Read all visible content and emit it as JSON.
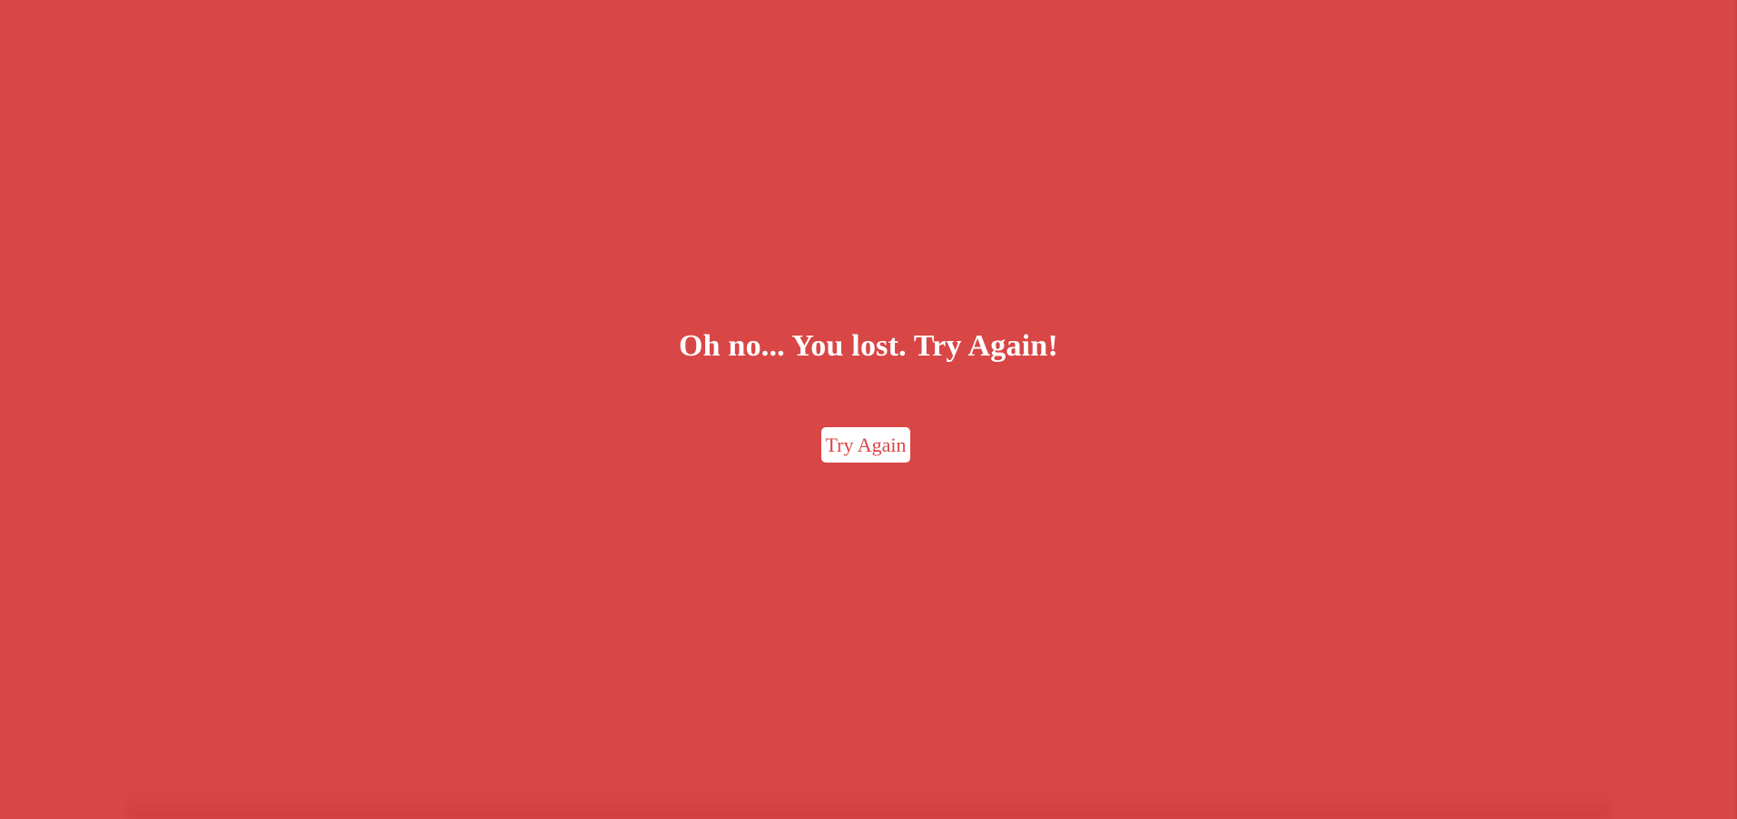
{
  "colors": {
    "background": "#d94646",
    "text": "#ffffff",
    "button_background": "#ffffff",
    "button_text": "#d94646"
  },
  "message": {
    "title": "Oh no... You lost. Try Again!"
  },
  "actions": {
    "try_again_label": "Try Again"
  }
}
